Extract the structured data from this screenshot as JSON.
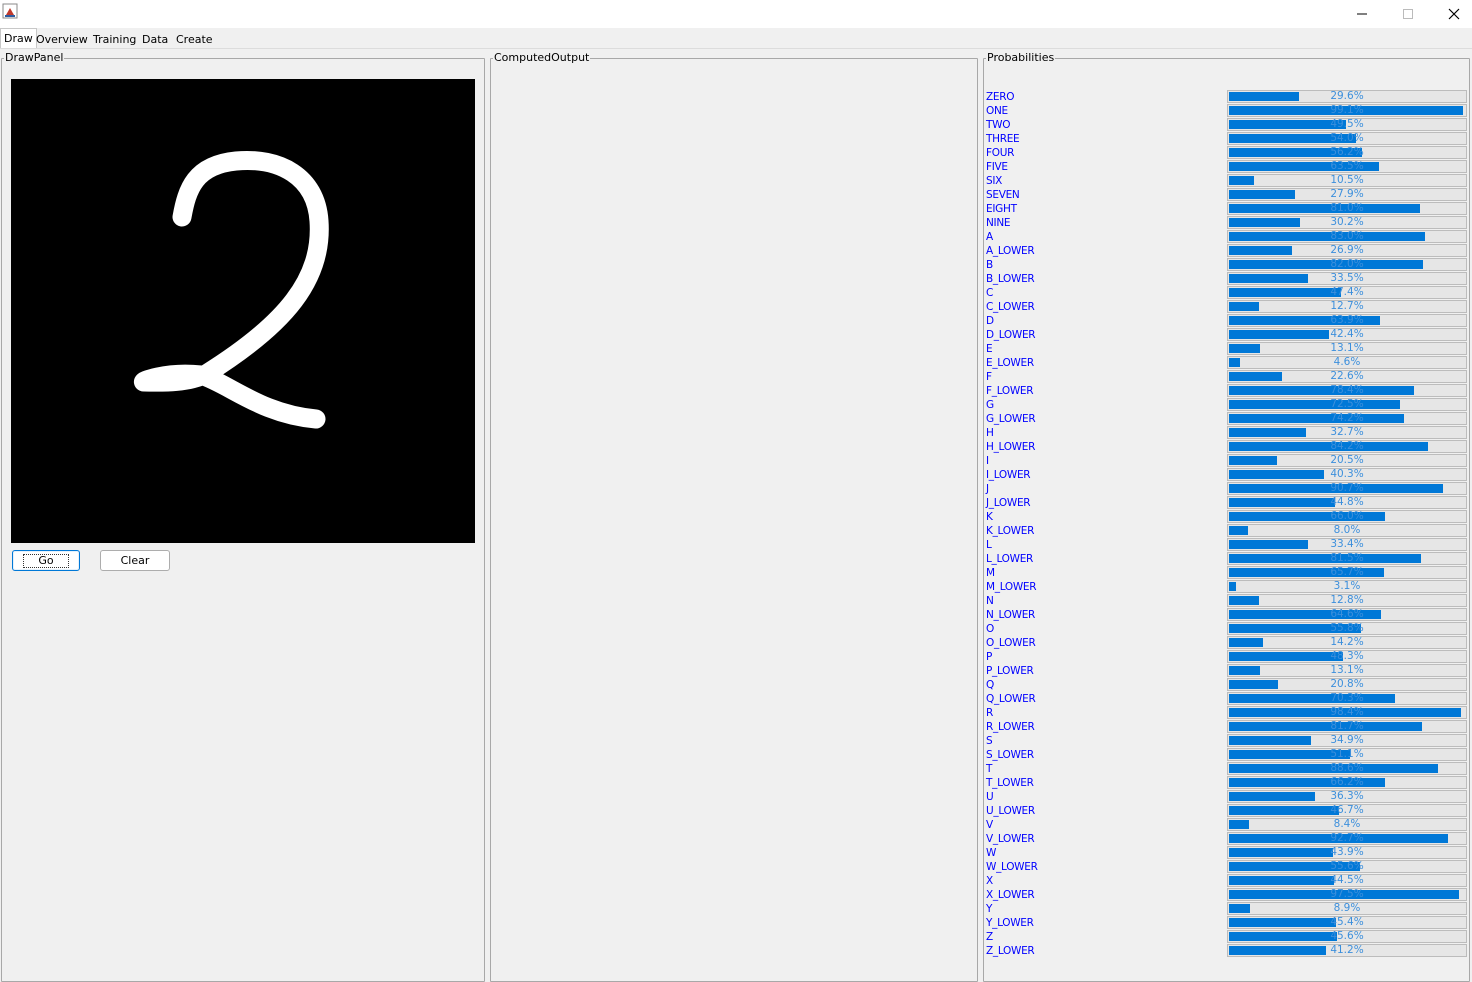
{
  "window": {
    "app_icon": "java-cup-icon",
    "controls": [
      "minimize-icon",
      "maximize-icon",
      "close-icon"
    ]
  },
  "tabs": [
    {
      "label": "Draw",
      "active": true
    },
    {
      "label": "Overview"
    },
    {
      "label": "Training"
    },
    {
      "label": "Data"
    },
    {
      "label": "Create"
    }
  ],
  "draw_panel": {
    "title": "DrawPanel",
    "canvas_content": "handwritten digit 2",
    "go_label": "Go",
    "clear_label": "Clear"
  },
  "computed_output": {
    "title": "ComputedOutput"
  },
  "probabilities": {
    "title": "Probabilities",
    "accent_color": "#0078d7",
    "label_color": "#0000ff",
    "items": [
      {
        "label": "ZERO",
        "value": 29.6,
        "text": "29.6%"
      },
      {
        "label": "ONE",
        "value": 99.1,
        "text": "99.1%"
      },
      {
        "label": "TWO",
        "value": 49.5,
        "text": "49.5%"
      },
      {
        "label": "THREE",
        "value": 54.0,
        "text": "54.0%"
      },
      {
        "label": "FOUR",
        "value": 56.2,
        "text": "56.2%"
      },
      {
        "label": "FIVE",
        "value": 63.5,
        "text": "63.5%"
      },
      {
        "label": "SIX",
        "value": 10.5,
        "text": "10.5%"
      },
      {
        "label": "SEVEN",
        "value": 27.9,
        "text": "27.9%"
      },
      {
        "label": "EIGHT",
        "value": 81.0,
        "text": "81.0%"
      },
      {
        "label": "NINE",
        "value": 30.2,
        "text": "30.2%"
      },
      {
        "label": "A",
        "value": 83.0,
        "text": "83.0%"
      },
      {
        "label": "A_LOWER",
        "value": 26.9,
        "text": "26.9%"
      },
      {
        "label": "B",
        "value": 82.0,
        "text": "82.0%"
      },
      {
        "label": "B_LOWER",
        "value": 33.5,
        "text": "33.5%"
      },
      {
        "label": "C",
        "value": 47.4,
        "text": "47.4%"
      },
      {
        "label": "C_LOWER",
        "value": 12.7,
        "text": "12.7%"
      },
      {
        "label": "D",
        "value": 63.9,
        "text": "63.9%"
      },
      {
        "label": "D_LOWER",
        "value": 42.4,
        "text": "42.4%"
      },
      {
        "label": "E",
        "value": 13.1,
        "text": "13.1%"
      },
      {
        "label": "E_LOWER",
        "value": 4.6,
        "text": "4.6%"
      },
      {
        "label": "F",
        "value": 22.6,
        "text": "22.6%"
      },
      {
        "label": "F_LOWER",
        "value": 78.4,
        "text": "78.4%"
      },
      {
        "label": "G",
        "value": 72.5,
        "text": "72.5%"
      },
      {
        "label": "G_LOWER",
        "value": 74.2,
        "text": "74.2%"
      },
      {
        "label": "H",
        "value": 32.7,
        "text": "32.7%"
      },
      {
        "label": "H_LOWER",
        "value": 84.2,
        "text": "84.2%"
      },
      {
        "label": "I",
        "value": 20.5,
        "text": "20.5%"
      },
      {
        "label": "I_LOWER",
        "value": 40.3,
        "text": "40.3%"
      },
      {
        "label": "J",
        "value": 90.7,
        "text": "90.7%"
      },
      {
        "label": "J_LOWER",
        "value": 44.8,
        "text": "44.8%"
      },
      {
        "label": "K",
        "value": 66.0,
        "text": "66.0%"
      },
      {
        "label": "K_LOWER",
        "value": 8.0,
        "text": "8.0%"
      },
      {
        "label": "L",
        "value": 33.4,
        "text": "33.4%"
      },
      {
        "label": "L_LOWER",
        "value": 81.5,
        "text": "81.5%"
      },
      {
        "label": "M",
        "value": 65.7,
        "text": "65.7%"
      },
      {
        "label": "M_LOWER",
        "value": 3.1,
        "text": "3.1%"
      },
      {
        "label": "N",
        "value": 12.8,
        "text": "12.8%"
      },
      {
        "label": "N_LOWER",
        "value": 64.6,
        "text": "64.6%"
      },
      {
        "label": "O",
        "value": 55.8,
        "text": "55.8%"
      },
      {
        "label": "O_LOWER",
        "value": 14.2,
        "text": "14.2%"
      },
      {
        "label": "P",
        "value": 48.3,
        "text": "48.3%"
      },
      {
        "label": "P_LOWER",
        "value": 13.1,
        "text": "13.1%"
      },
      {
        "label": "Q",
        "value": 20.8,
        "text": "20.8%"
      },
      {
        "label": "Q_LOWER",
        "value": 70.3,
        "text": "70.3%"
      },
      {
        "label": "R",
        "value": 98.4,
        "text": "98.4%"
      },
      {
        "label": "R_LOWER",
        "value": 81.7,
        "text": "81.7%"
      },
      {
        "label": "S",
        "value": 34.9,
        "text": "34.9%"
      },
      {
        "label": "S_LOWER",
        "value": 51.1,
        "text": "51.1%"
      },
      {
        "label": "T",
        "value": 88.6,
        "text": "88.6%"
      },
      {
        "label": "T_LOWER",
        "value": 66.2,
        "text": "66.2%"
      },
      {
        "label": "U",
        "value": 36.3,
        "text": "36.3%"
      },
      {
        "label": "U_LOWER",
        "value": 46.7,
        "text": "46.7%"
      },
      {
        "label": "V",
        "value": 8.4,
        "text": "8.4%"
      },
      {
        "label": "V_LOWER",
        "value": 92.7,
        "text": "92.7%"
      },
      {
        "label": "W",
        "value": 43.9,
        "text": "43.9%"
      },
      {
        "label": "W_LOWER",
        "value": 55.6,
        "text": "55.6%"
      },
      {
        "label": "X",
        "value": 44.5,
        "text": "44.5%"
      },
      {
        "label": "X_LOWER",
        "value": 97.5,
        "text": "97.5%"
      },
      {
        "label": "Y",
        "value": 8.9,
        "text": "8.9%"
      },
      {
        "label": "Y_LOWER",
        "value": 45.4,
        "text": "45.4%"
      },
      {
        "label": "Z",
        "value": 45.6,
        "text": "45.6%"
      },
      {
        "label": "Z_LOWER",
        "value": 41.2,
        "text": "41.2%"
      }
    ]
  }
}
